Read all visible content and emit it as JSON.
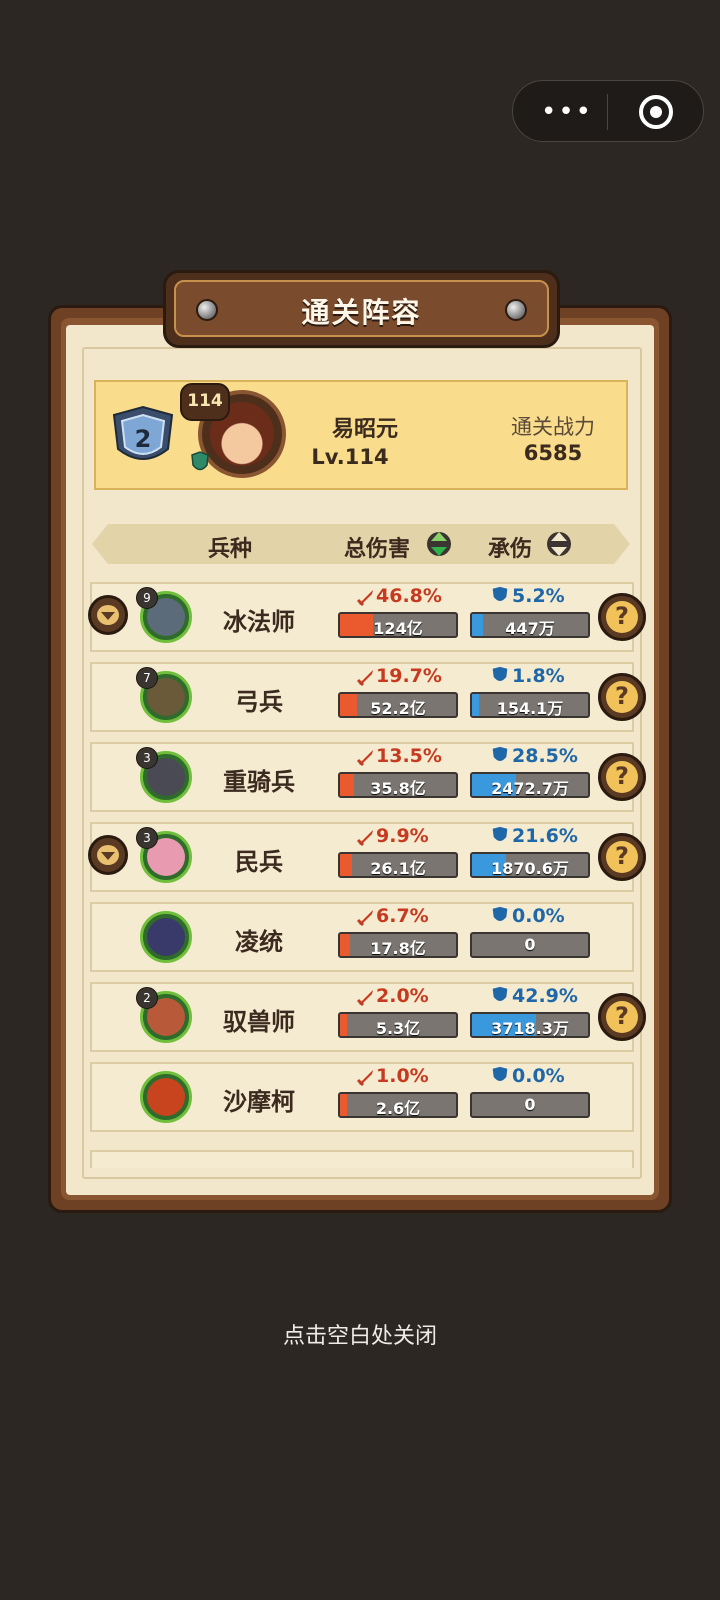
{
  "capsule": {
    "more_icon": "more-dots-icon",
    "close_icon": "target-icon"
  },
  "dialog": {
    "title": "通关阵容"
  },
  "player": {
    "rank": "2",
    "avatar_level": "114",
    "name": "易昭元",
    "level": "Lv.114",
    "power_label": "通关战力",
    "power_value": "6585"
  },
  "table": {
    "headers": {
      "unit": "兵种",
      "damage": "总伤害",
      "tank": "承伤"
    },
    "rows": [
      {
        "name": "冰法师",
        "count": "9",
        "expandable": true,
        "help": true,
        "dmg_pct": "46.8%",
        "dmg_val": "124亿",
        "dmg_share": 0.468,
        "tank_pct": "5.2%",
        "tank_val": "447万",
        "tank_share": 0.052,
        "color": "#5c6b7a"
      },
      {
        "name": "弓兵",
        "count": "7",
        "expandable": false,
        "help": true,
        "dmg_pct": "19.7%",
        "dmg_val": "52.2亿",
        "dmg_share": 0.197,
        "tank_pct": "1.8%",
        "tank_val": "154.1万",
        "tank_share": 0.018,
        "color": "#6b5a3a"
      },
      {
        "name": "重骑兵",
        "count": "3",
        "expandable": false,
        "help": true,
        "dmg_pct": "13.5%",
        "dmg_val": "35.8亿",
        "dmg_share": 0.135,
        "tank_pct": "28.5%",
        "tank_val": "2472.7万",
        "tank_share": 0.285,
        "color": "#4a4a55"
      },
      {
        "name": "民兵",
        "count": "3",
        "expandable": true,
        "help": true,
        "dmg_pct": "9.9%",
        "dmg_val": "26.1亿",
        "dmg_share": 0.099,
        "tank_pct": "21.6%",
        "tank_val": "1870.6万",
        "tank_share": 0.216,
        "color": "#e89ab0"
      },
      {
        "name": "凌统",
        "count": "",
        "expandable": false,
        "help": false,
        "dmg_pct": "6.7%",
        "dmg_val": "17.8亿",
        "dmg_share": 0.067,
        "tank_pct": "0.0%",
        "tank_val": "0",
        "tank_share": 0.0,
        "color": "#3a3a6a"
      },
      {
        "name": "驭兽师",
        "count": "2",
        "expandable": false,
        "help": true,
        "dmg_pct": "2.0%",
        "dmg_val": "5.3亿",
        "dmg_share": 0.02,
        "tank_pct": "42.9%",
        "tank_val": "3718.3万",
        "tank_share": 0.429,
        "color": "#b85a3a"
      },
      {
        "name": "沙摩柯",
        "count": "",
        "expandable": false,
        "help": false,
        "dmg_pct": "1.0%",
        "dmg_val": "2.6亿",
        "dmg_share": 0.01,
        "tank_pct": "0.0%",
        "tank_val": "0",
        "tank_share": 0.0,
        "color": "#c8441f"
      }
    ]
  },
  "footer": {
    "close_hint": "点击空白处关闭"
  }
}
